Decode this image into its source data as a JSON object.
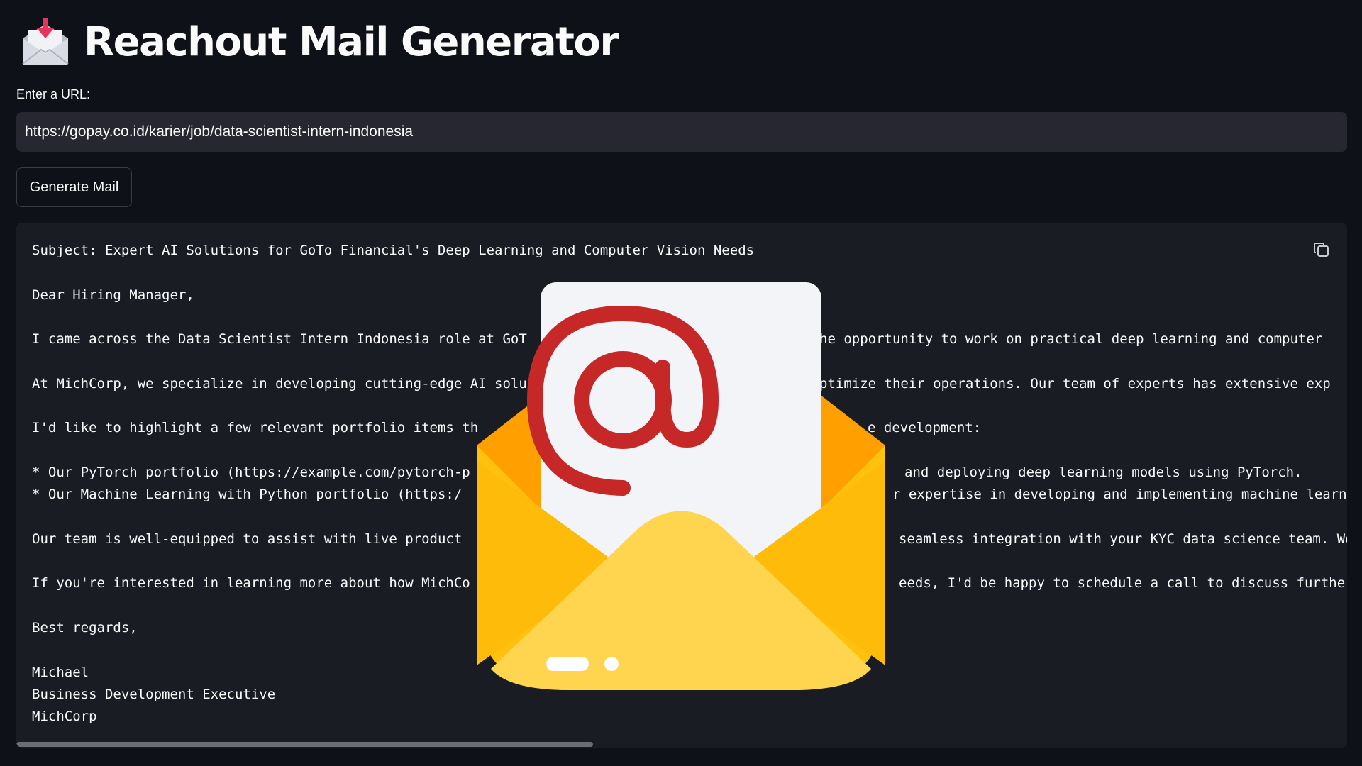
{
  "app": {
    "title": "Reachout Mail Generator",
    "title_icon": "incoming-envelope-icon"
  },
  "form": {
    "url_label": "Enter a URL:",
    "url_value": "https://gopay.co.id/karier/job/data-scientist-intern-indonesia",
    "generate_label": "Generate Mail"
  },
  "output": {
    "copy_icon": "copy-icon",
    "lines": [
      "Subject: Expert AI Solutions for GoTo Financial's Deep Learning and Computer Vision Needs",
      "",
      "Dear Hiring Manager,",
      "",
      "I came across the Data Scientist Intern Indonesia role at GoT",
      "",
      "At MichCorp, we specialize in developing cutting-edge AI solu",
      "",
      "I'd like to highlight a few relevant portfolio items th",
      "",
      "* Our PyTorch portfolio (https://example.com/pytorch-p",
      "* Our Machine Learning with Python portfolio (https:/",
      "",
      "Our team is well-equipped to assist with live product",
      "",
      "If you're interested in learning more about how MichCo",
      "",
      "Best regards,",
      "",
      "Michael",
      "Business Development Executive",
      "MichCorp"
    ],
    "right_fragments": [
      "he opportunity to work on practical deep learning and computer",
      "ptimize their operations. Our team of experts has extensive exp",
      "e development:",
      "and deploying deep learning models using PyTorch.",
      "r expertise in developing and implementing machine learn",
      "seamless integration with your KYC data science team. We",
      "eeds, I'd be happy to schedule a call to discuss further"
    ]
  },
  "overlay": {
    "icon": "open-envelope-at-sign-icon"
  },
  "colors": {
    "background": "#0e1117",
    "input_bg": "#262730",
    "code_bg": "#1a1c24",
    "text": "#fafafa",
    "at_sign": "#c62828",
    "envelope_yellow": "#fec10e",
    "envelope_orange": "#ffa000"
  }
}
